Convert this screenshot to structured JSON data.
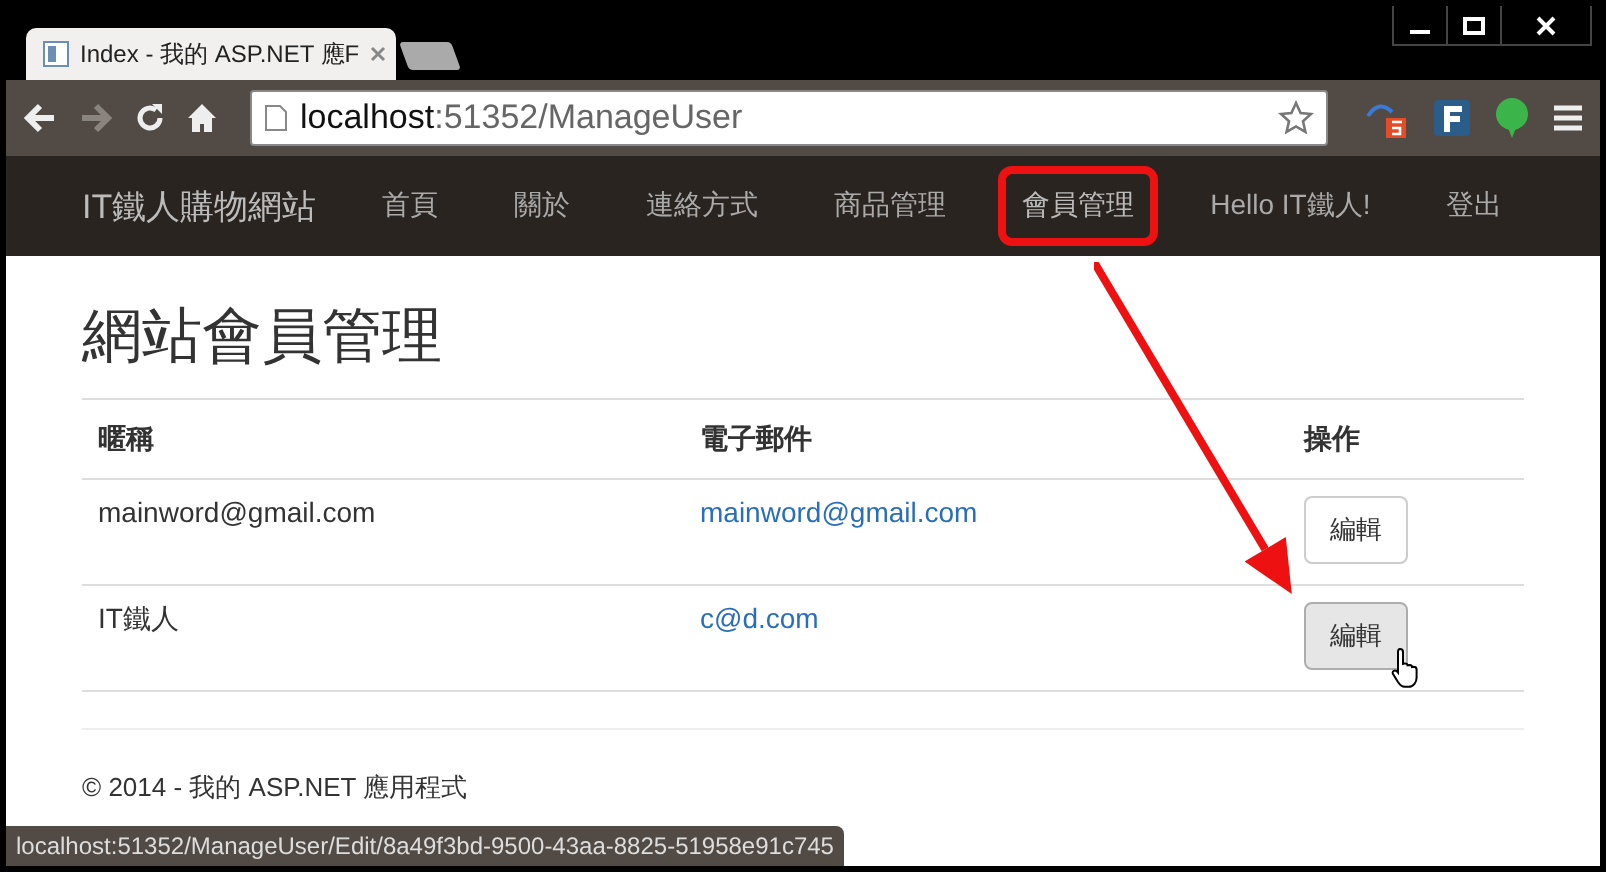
{
  "browser": {
    "tab_title": "Index - 我的 ASP.NET 應F",
    "url_host": "localhost",
    "url_rest": ":51352/ManageUser"
  },
  "navbar": {
    "brand": "IT鐵人購物網站",
    "items": [
      {
        "label": "首頁",
        "highlighted": false
      },
      {
        "label": "關於",
        "highlighted": false
      },
      {
        "label": "連絡方式",
        "highlighted": false
      },
      {
        "label": "商品管理",
        "highlighted": false
      },
      {
        "label": "會員管理",
        "highlighted": true
      }
    ],
    "greeting": "Hello IT鐵人!",
    "logout": "登出"
  },
  "page": {
    "heading": "網站會員管理",
    "table": {
      "columns": [
        "暱稱",
        "電子郵件",
        "操作"
      ],
      "rows": [
        {
          "nickname": "mainword@gmail.com",
          "email": "mainword@gmail.com",
          "action": "編輯",
          "hovered": false
        },
        {
          "nickname": "IT鐵人",
          "email": "c@d.com",
          "action": "編輯",
          "hovered": true
        }
      ]
    },
    "footer": "© 2014 - 我的 ASP.NET 應用程式"
  },
  "status_bar": "localhost:51352/ManageUser/Edit/8a49f3bd-9500-43aa-8825-51958e91c745"
}
